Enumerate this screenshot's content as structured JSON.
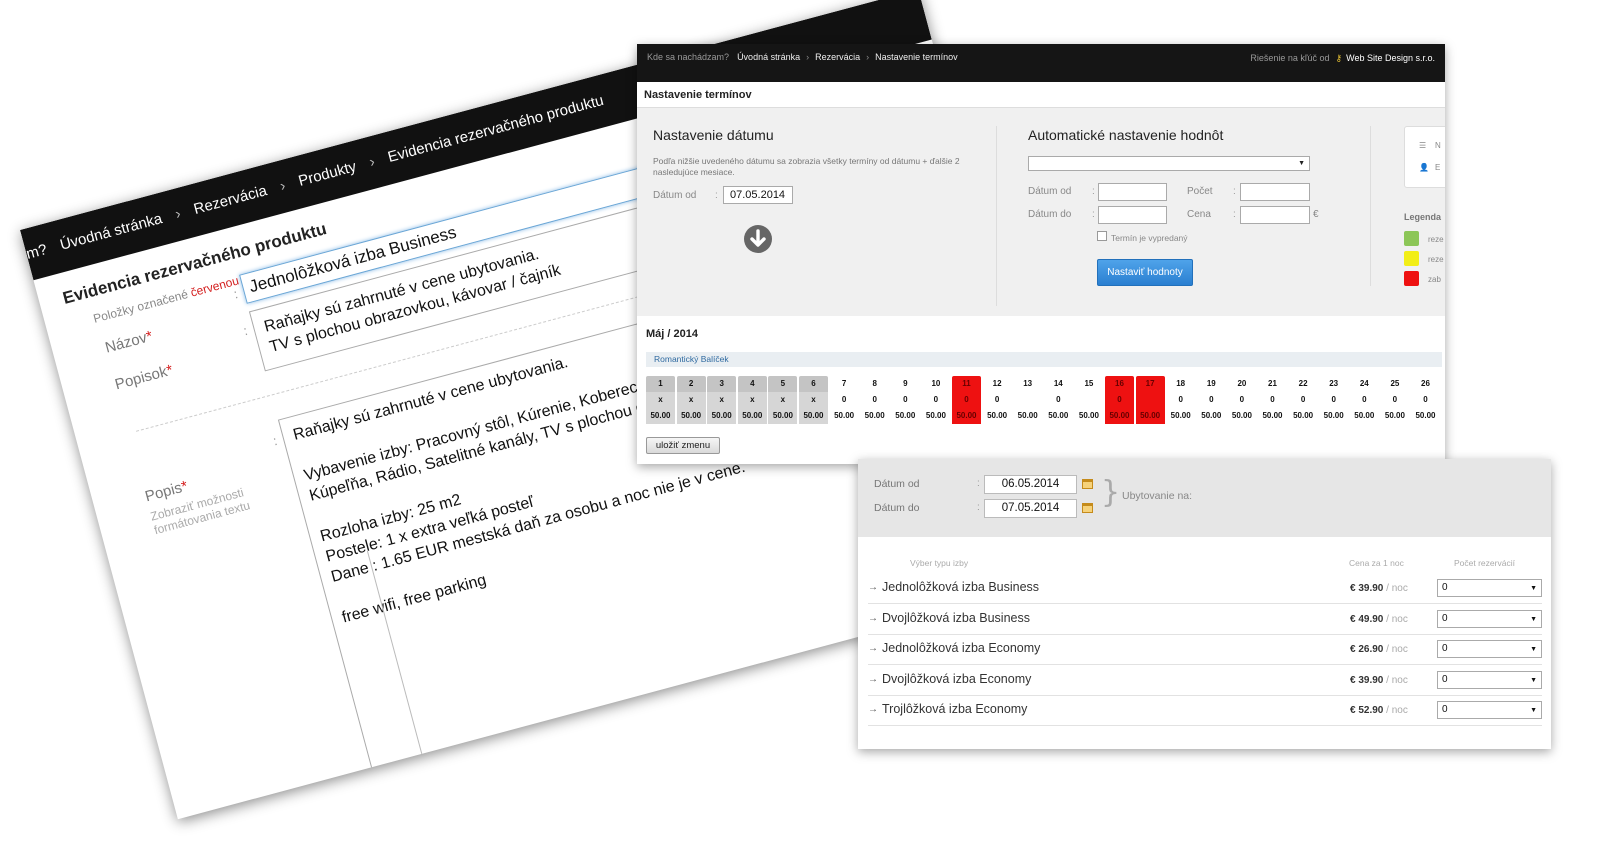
{
  "form_panel": {
    "breadcrumb": [
      "m?",
      "Úvodná stránka",
      "Rezervácia",
      "Produkty",
      "Evidencia rezervačného produktu"
    ],
    "breadcrumb_right": "Riešenie na kľúč od",
    "title": "Evidencia rezervačného produktu",
    "note_before": "Položky označené ",
    "note_red": "červenou",
    "note_after": " hviezdičkou * sú povinné a preto ich treba vyplniť.",
    "fields": {
      "nazov_label": "Názov",
      "nazov_value": "Jednolôžková izba Business",
      "popisok_label": "Popisok",
      "popisok_line1": "Raňajky sú zahrnuté v cene ubytovania.",
      "popisok_line2": "TV s plochou obrazovkou, kávovar / čajník",
      "popis_label": "Popis",
      "popis_link": "Zobraziť možnosti formátovania textu",
      "popis_lines": [
        "Raňajky sú zahrnuté v cene ubytovania.",
        "",
        "Vybavenie izby: Pracovný stôl, Kúrenie, Koberec, Sprch",
        "Kúpeľňa, Rádio, Satelitné kanály, TV s plochou obrazo",
        "",
        "Rozloha izby: 25 m2",
        "Postele: 1 x extra veľká posteľ",
        "Dane : 1.65 EUR mestská daň za osobu a noc nie je v cene.",
        "",
        "free wifi, free parking"
      ],
      "required_mark": "*"
    }
  },
  "calendar_panel": {
    "topbar": {
      "question": "Kde sa nachádzam?",
      "crumbs": [
        "Úvodná stránka",
        "Rezervácia",
        "Nastavenie termínov"
      ],
      "right_text": "Riešenie na kľúč od",
      "right_brand": "Web Site Design s.r.o."
    },
    "header": "Nastavenie termínov",
    "date_section": {
      "title": "Nastavenie dátumu",
      "help": "Podľa nižšie uvedeného dátumu sa zobrazia všetky termíny od dátumu + ďalšie 2 nasledujúce mesiace.",
      "datum_od_label": "Dátum od",
      "datum_od_value": "07.05.2014"
    },
    "auto_section": {
      "title": "Automatické nastavenie hodnôt",
      "datum_od_label": "Dátum od",
      "datum_do_label": "Dátum do",
      "pocet_label": "Počet",
      "cena_label": "Cena",
      "currency": "€",
      "sold_out_label": "Termín je vypredaný",
      "button": "Nastaviť hodnoty"
    },
    "side": {
      "item1": "N",
      "item2": "E",
      "legend_title": "Legenda",
      "legend": [
        {
          "label": "reze",
          "color": "#8cc657"
        },
        {
          "label": "reze",
          "color": "#f2ee17"
        },
        {
          "label": "zab",
          "color": "#ee1111"
        }
      ]
    },
    "month": "Máj / 2014",
    "package": "Romantický Balíček",
    "days": [
      {
        "d": "1",
        "q": "x",
        "p": "50.00",
        "s": "grey"
      },
      {
        "d": "2",
        "q": "x",
        "p": "50.00",
        "s": "grey"
      },
      {
        "d": "3",
        "q": "x",
        "p": "50.00",
        "s": "grey"
      },
      {
        "d": "4",
        "q": "x",
        "p": "50.00",
        "s": "grey"
      },
      {
        "d": "5",
        "q": "x",
        "p": "50.00",
        "s": "grey"
      },
      {
        "d": "6",
        "q": "x",
        "p": "50.00",
        "s": "grey"
      },
      {
        "d": "7",
        "q": "0",
        "p": "50.00",
        "s": "normal"
      },
      {
        "d": "8",
        "q": "0",
        "p": "50.00",
        "s": "normal"
      },
      {
        "d": "9",
        "q": "0",
        "p": "50.00",
        "s": "normal"
      },
      {
        "d": "10",
        "q": "0",
        "p": "50.00",
        "s": "normal"
      },
      {
        "d": "11",
        "q": "0",
        "p": "50.00",
        "s": "red"
      },
      {
        "d": "12",
        "q": "0",
        "p": "50.00",
        "s": "normal"
      },
      {
        "d": "13",
        "q": "",
        "p": "50.00",
        "s": "normal"
      },
      {
        "d": "14",
        "q": "0",
        "p": "50.00",
        "s": "normal"
      },
      {
        "d": "15",
        "q": "",
        "p": "50.00",
        "s": "normal"
      },
      {
        "d": "16",
        "q": "0",
        "p": "50.00",
        "s": "red"
      },
      {
        "d": "17",
        "q": "",
        "p": "50.00",
        "s": "red"
      },
      {
        "d": "18",
        "q": "0",
        "p": "50.00",
        "s": "normal"
      },
      {
        "d": "19",
        "q": "0",
        "p": "50.00",
        "s": "normal"
      },
      {
        "d": "20",
        "q": "0",
        "p": "50.00",
        "s": "normal"
      },
      {
        "d": "21",
        "q": "0",
        "p": "50.00",
        "s": "normal"
      },
      {
        "d": "22",
        "q": "0",
        "p": "50.00",
        "s": "normal"
      },
      {
        "d": "23",
        "q": "0",
        "p": "50.00",
        "s": "normal"
      },
      {
        "d": "24",
        "q": "0",
        "p": "50.00",
        "s": "normal"
      },
      {
        "d": "25",
        "q": "0",
        "p": "50.00",
        "s": "normal"
      },
      {
        "d": "26",
        "q": "0",
        "p": "50.00",
        "s": "normal"
      }
    ],
    "save_button": "uložiť zmenu"
  },
  "booking_panel": {
    "datum_od_label": "Dátum od",
    "datum_od_value": "06.05.2014",
    "datum_do_label": "Dátum do",
    "datum_do_value": "07.05.2014",
    "ubytovanie_label": "Ubytovanie na:",
    "col_type": "Výber typu izby",
    "col_price": "Cena za 1 noc",
    "col_count": "Počet rezervácií",
    "per_night": "/ noc",
    "rooms": [
      {
        "name": "Jednolôžková izba Business",
        "price": "€ 39.90",
        "count": "0"
      },
      {
        "name": "Dvojlôžková izba Business",
        "price": "€ 49.90",
        "count": "0"
      },
      {
        "name": "Jednolôžková izba Economy",
        "price": "€ 26.90",
        "count": "0"
      },
      {
        "name": "Dvojlôžková izba Economy",
        "price": "€ 39.90",
        "count": "0"
      },
      {
        "name": "Trojlôžková izba Economy",
        "price": "€ 52.90",
        "count": "0"
      }
    ]
  }
}
